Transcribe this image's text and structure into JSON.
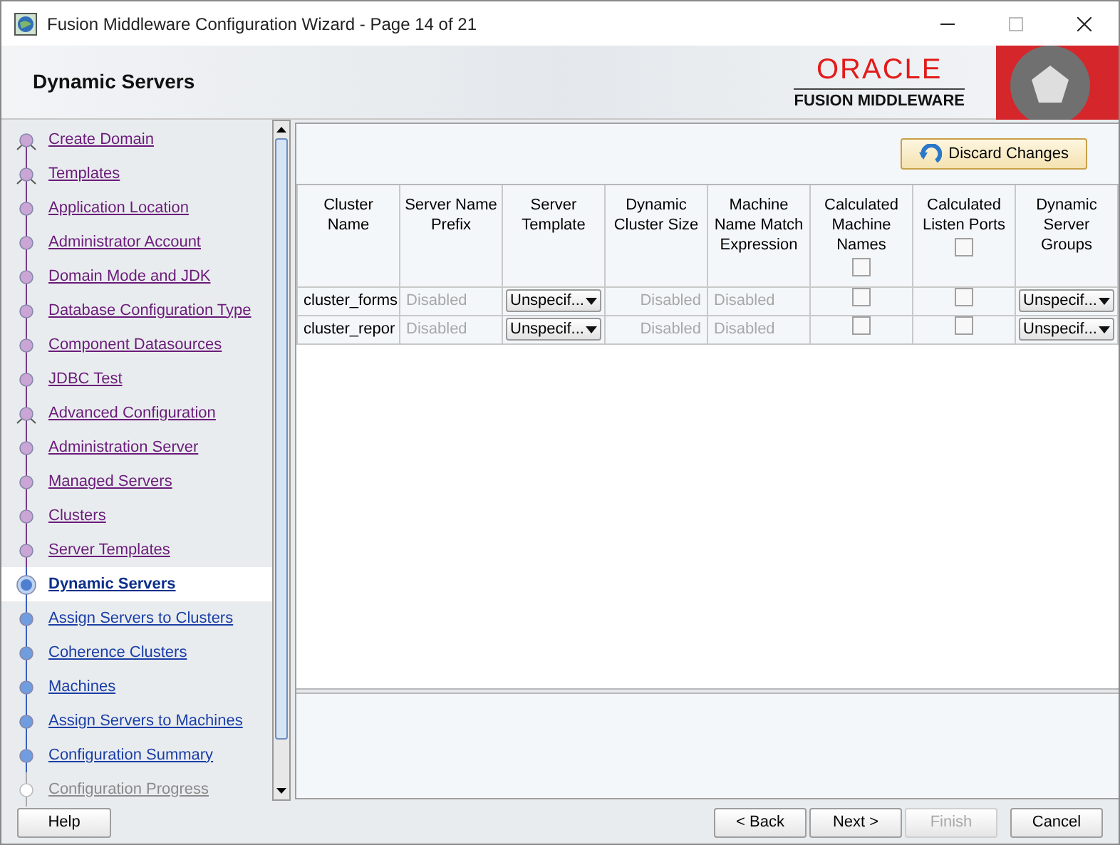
{
  "window": {
    "title": "Fusion Middleware Configuration Wizard - Page 14 of 21"
  },
  "header": {
    "title": "Dynamic Servers",
    "logo_top": "ORACLE",
    "logo_bottom": "FUSION MIDDLEWARE"
  },
  "steps": [
    {
      "label": "Create Domain",
      "kind": "visited",
      "selected": false,
      "branch": true
    },
    {
      "label": "Templates",
      "kind": "visited",
      "selected": false,
      "branch": true
    },
    {
      "label": "Application Location",
      "kind": "visited",
      "selected": false,
      "branch": false
    },
    {
      "label": "Administrator Account",
      "kind": "visited",
      "selected": false,
      "branch": false
    },
    {
      "label": "Domain Mode and JDK",
      "kind": "visited",
      "selected": false,
      "branch": false
    },
    {
      "label": "Database Configuration Type",
      "kind": "visited",
      "selected": false,
      "branch": false
    },
    {
      "label": "Component Datasources",
      "kind": "visited",
      "selected": false,
      "branch": false
    },
    {
      "label": "JDBC Test",
      "kind": "visited",
      "selected": false,
      "branch": false
    },
    {
      "label": "Advanced Configuration",
      "kind": "visited",
      "selected": false,
      "branch": true
    },
    {
      "label": "Administration Server",
      "kind": "visited",
      "selected": false,
      "branch": false
    },
    {
      "label": "Managed Servers",
      "kind": "visited",
      "selected": false,
      "branch": false
    },
    {
      "label": "Clusters",
      "kind": "visited",
      "selected": false,
      "branch": false
    },
    {
      "label": "Server Templates",
      "kind": "visited",
      "selected": false,
      "branch": false
    },
    {
      "label": "Dynamic Servers",
      "kind": "pending",
      "selected": true,
      "branch": false
    },
    {
      "label": "Assign Servers to Clusters",
      "kind": "pending",
      "selected": false,
      "branch": false
    },
    {
      "label": "Coherence Clusters",
      "kind": "pending",
      "selected": false,
      "branch": false
    },
    {
      "label": "Machines",
      "kind": "pending",
      "selected": false,
      "branch": false
    },
    {
      "label": "Assign Servers to Machines",
      "kind": "pending",
      "selected": false,
      "branch": false
    },
    {
      "label": "Configuration Summary",
      "kind": "pending",
      "selected": false,
      "branch": false
    },
    {
      "label": "Configuration Progress",
      "kind": "disabled",
      "selected": false,
      "branch": false
    }
  ],
  "discard_button": "Discard Changes",
  "table": {
    "columns": [
      {
        "label": "Cluster Name"
      },
      {
        "label": "Server Name Prefix"
      },
      {
        "label": "Server Template"
      },
      {
        "label": "Dynamic Cluster Size"
      },
      {
        "label": "Machine Name Match Expression"
      },
      {
        "label": "Calculated Machine Names",
        "checked": false
      },
      {
        "label": "Calculated Listen Ports",
        "checked": false
      },
      {
        "label": "Dynamic Server Groups"
      }
    ],
    "rows": [
      {
        "cells": [
          {
            "kind": "text",
            "text": "cluster_forms"
          },
          {
            "kind": "disabled",
            "text": "Disabled"
          },
          {
            "kind": "dropdown",
            "text": "Unspecif..."
          },
          {
            "kind": "numeric",
            "text": "Disabled"
          },
          {
            "kind": "disabled",
            "text": "Disabled"
          },
          {
            "kind": "checkbox",
            "checked": false
          },
          {
            "kind": "checkbox",
            "checked": false
          },
          {
            "kind": "dropdown",
            "text": "Unspecif..."
          }
        ]
      },
      {
        "cells": [
          {
            "kind": "text",
            "text": "cluster_repor"
          },
          {
            "kind": "disabled",
            "text": "Disabled"
          },
          {
            "kind": "dropdown",
            "text": "Unspecif..."
          },
          {
            "kind": "numeric",
            "text": "Disabled"
          },
          {
            "kind": "disabled",
            "text": "Disabled"
          },
          {
            "kind": "checkbox",
            "checked": false
          },
          {
            "kind": "checkbox",
            "checked": false
          },
          {
            "kind": "dropdown",
            "text": "Unspecif..."
          }
        ]
      }
    ]
  },
  "buttons": [
    {
      "label": "Help",
      "disabled": false
    },
    {
      "label": "< Back",
      "disabled": false
    },
    {
      "label": "Next >",
      "disabled": false
    },
    {
      "label": "Finish",
      "disabled": true
    },
    {
      "label": "Cancel",
      "disabled": false
    }
  ]
}
